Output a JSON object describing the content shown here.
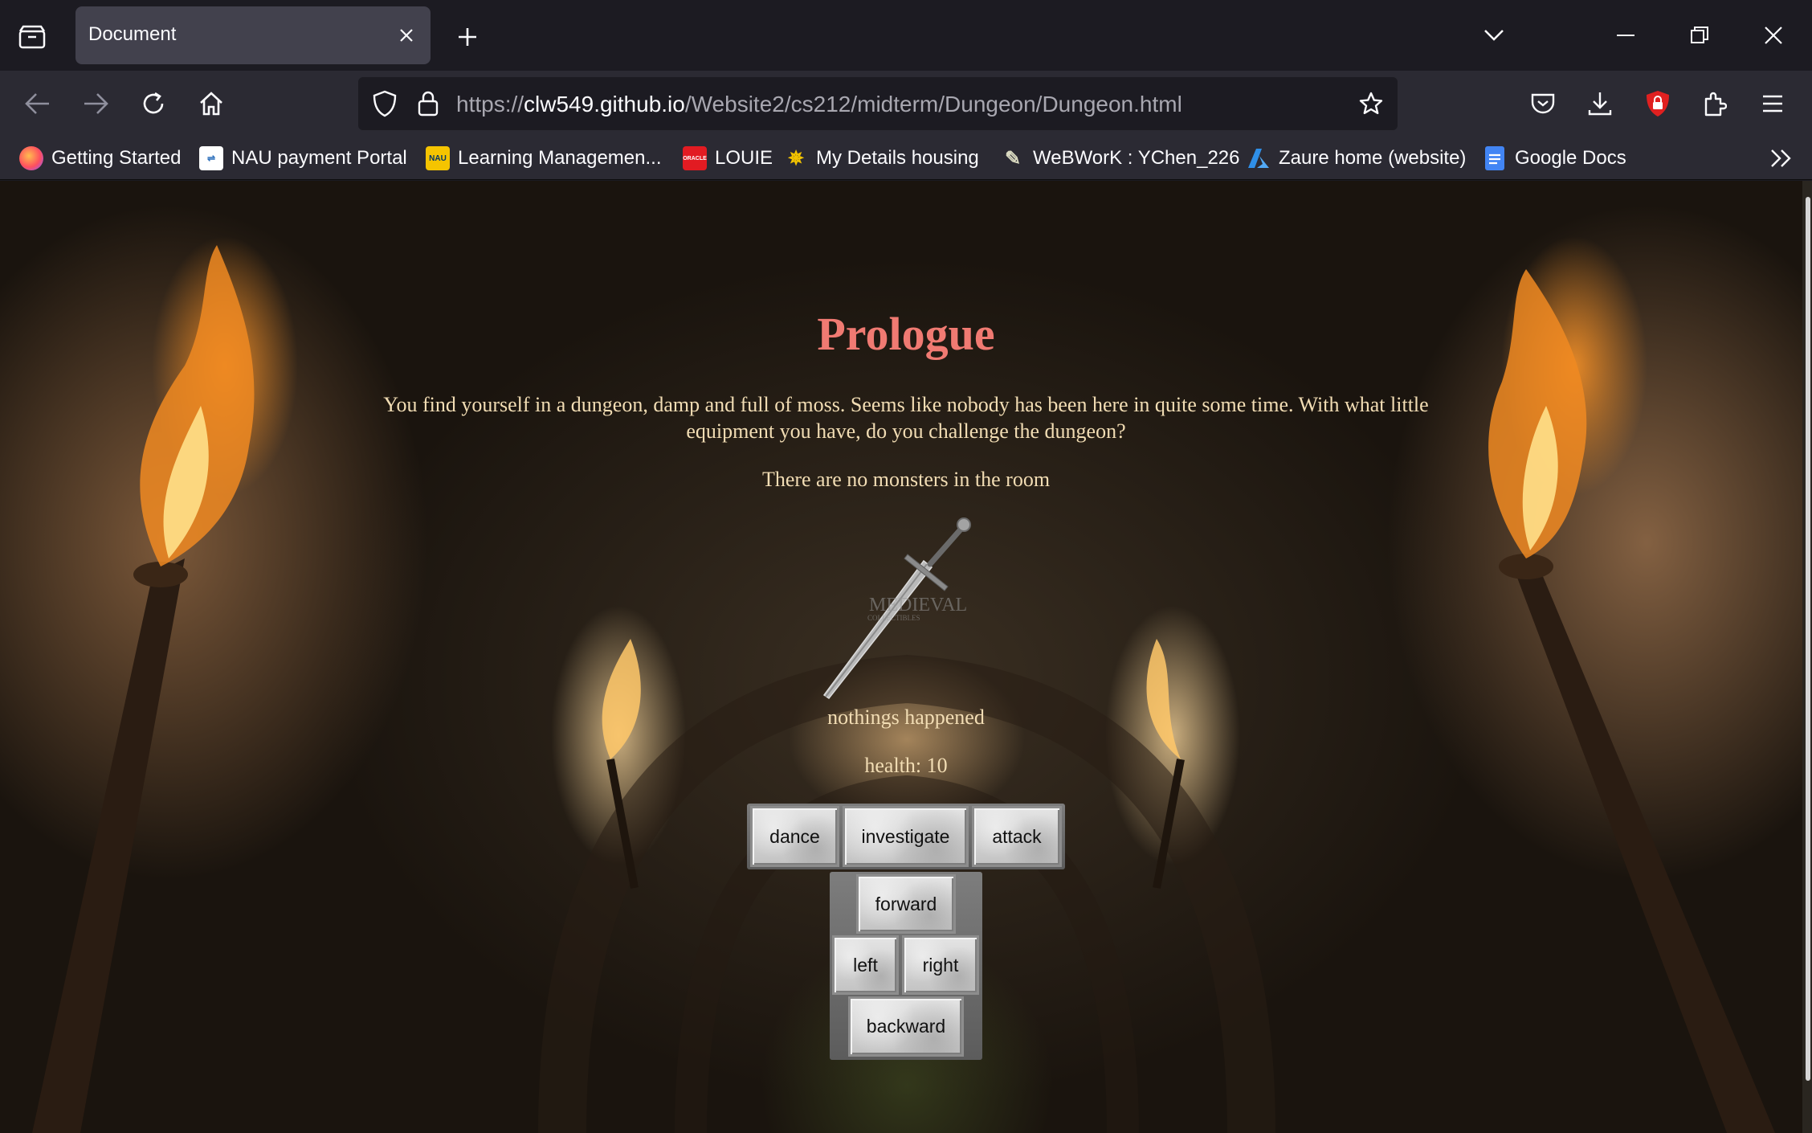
{
  "browser": {
    "tab_title": "Document",
    "url_scheme": "https://",
    "url_host": "clw549.github.io",
    "url_path": "/Website2/cs212/midterm/Dungeon/Dungeon.html",
    "bookmarks": [
      {
        "label": "Getting Started",
        "icon": "firefox-icon"
      },
      {
        "label": "NAU payment Portal",
        "icon": "payment-portal-icon"
      },
      {
        "label": "Learning Managemen...",
        "icon": "nau-icon"
      },
      {
        "label": "LOUIE",
        "icon": "oracle-icon"
      },
      {
        "label": "My Details housing",
        "icon": "housing-icon"
      },
      {
        "label": "WeBWorK : YChen_226",
        "icon": "webwork-icon"
      },
      {
        "label": "Zaure home (website)",
        "icon": "azure-icon"
      },
      {
        "label": "Google Docs",
        "icon": "google-docs-icon"
      }
    ]
  },
  "game": {
    "title": "Prologue",
    "intro": "You find yourself in a dungeon, damp and full of moss. Seems like nobody has been here in quite some time. With what little equipment you have, do you challenge the dungeon?",
    "monster_status": "There are no monsters in the room",
    "weapon_watermark": "MEDIEVAL",
    "weapon_watermark_sub": "COLLECTIBLES",
    "event_text": "nothings happened",
    "health_text": "health: 10",
    "actions": {
      "dance": "dance",
      "investigate": "investigate",
      "attack": "attack"
    },
    "movement": {
      "forward": "forward",
      "left": "left",
      "right": "right",
      "backward": "backward"
    }
  }
}
